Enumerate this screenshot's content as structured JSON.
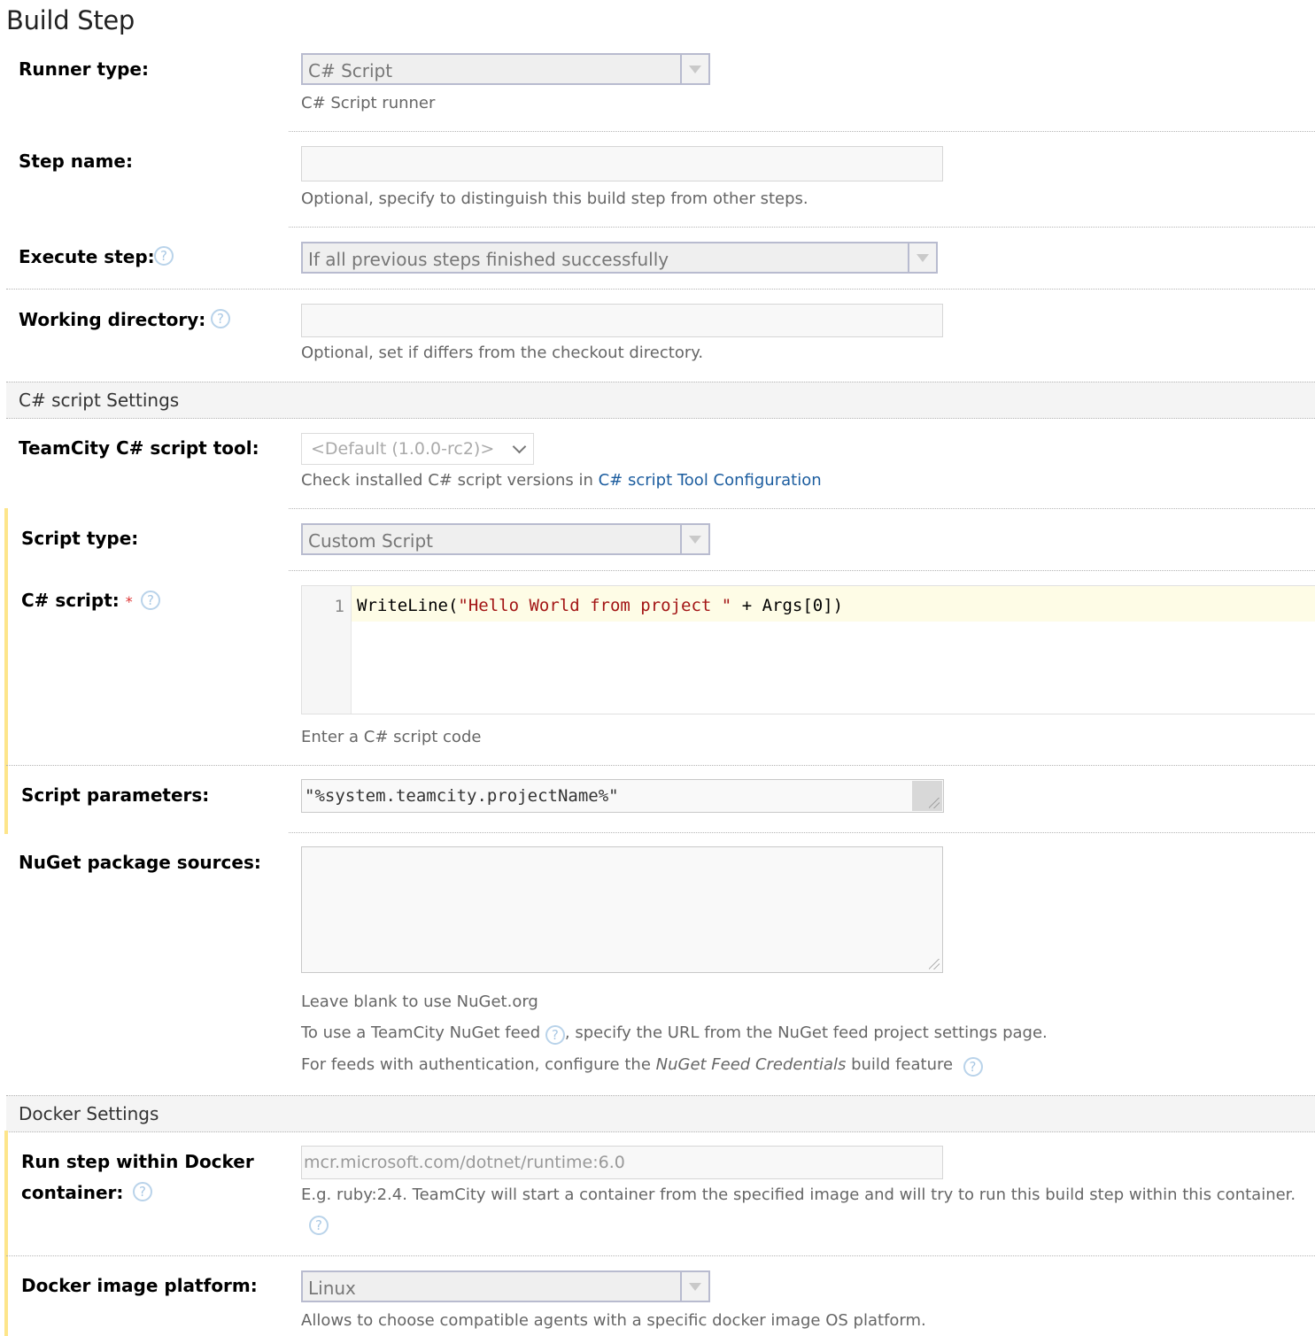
{
  "page": {
    "title": "Build Step"
  },
  "runner_type": {
    "label": "Runner type:",
    "value": "C# Script",
    "note": "C# Script runner"
  },
  "step_name": {
    "label": "Step name:",
    "value": "",
    "note": "Optional, specify to distinguish this build step from other steps."
  },
  "execute_step": {
    "label": "Execute step:",
    "value": "If all previous steps finished successfully"
  },
  "working_directory": {
    "label": "Working directory:",
    "value": "",
    "note": "Optional, set if differs from the checkout directory."
  },
  "csharp_section": {
    "title": "C# script Settings",
    "tool": {
      "label": "TeamCity C# script tool:",
      "value": "<Default (1.0.0-rc2)>",
      "note_prefix": "Check installed C# script versions in ",
      "note_link": "C# script Tool Configuration"
    },
    "script_type": {
      "label": "Script type:",
      "value": "Custom Script"
    },
    "script": {
      "label": "C# script:",
      "required_mark": "*",
      "line_number": "1",
      "code_prefix": "WriteLine(",
      "code_string": "\"Hello World from project \"",
      "code_suffix": " + Args[0])",
      "note": "Enter a C# script code"
    },
    "script_parameters": {
      "label": "Script parameters:",
      "value": "\"%system.teamcity.projectName%\""
    },
    "nuget_sources": {
      "label": "NuGet package sources:",
      "value": "",
      "note_line1": "Leave blank to use NuGet.org",
      "note_line2_prefix": "To use a TeamCity NuGet feed ",
      "note_line2_suffix": ", specify the URL from the NuGet feed project settings page.",
      "note_line3_prefix": "For feeds with authentication, configure the ",
      "note_line3_italic": "NuGet Feed Credentials",
      "note_line3_suffix": " build feature"
    }
  },
  "docker_section": {
    "title": "Docker Settings",
    "container": {
      "label_line1": "Run step within Docker",
      "label_line2": "container:",
      "placeholder": "mcr.microsoft.com/dotnet/runtime:6.0",
      "note": "E.g. ruby:2.4. TeamCity will start a container from the specified image and will try to run this build step within this container."
    },
    "platform": {
      "label": "Docker image platform:",
      "value": "Linux",
      "note": "Allows to choose compatible agents with a specific docker image OS platform."
    }
  },
  "colors": {
    "link": "#1c5d9f",
    "highlight_bar": "#fde58a",
    "code_string": "#a31515",
    "help_icon": "#b9d3ea"
  }
}
